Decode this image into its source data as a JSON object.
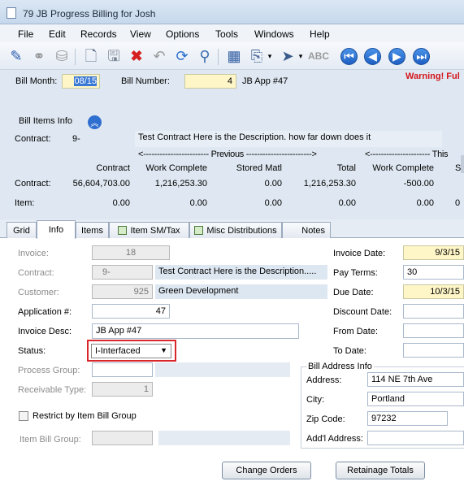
{
  "window": {
    "title": "79 JB Progress Billing for Josh"
  },
  "menu": [
    "File",
    "Edit",
    "Records",
    "View",
    "Options",
    "Tools",
    "Windows",
    "Help"
  ],
  "toolbar": {
    "icons": [
      "edit-icon",
      "binoculars-icon",
      "database-icon",
      "new-document-icon",
      "save-icon",
      "delete-icon",
      "undo-icon",
      "refresh-icon",
      "find-icon",
      "calculator-icon",
      "attach-icon",
      "dropdown-arrow-icon",
      "reports-icon",
      "spellcheck-icon",
      "first-record-icon",
      "prev-record-icon",
      "next-record-icon",
      "last-record-icon"
    ]
  },
  "header": {
    "bill_month_label": "Bill Month:",
    "bill_month_value": "08/15",
    "bill_number_label": "Bill Number:",
    "bill_number_value": "4",
    "bill_desc": "JB App #47",
    "warning": "Warning!  Ful"
  },
  "bill_items": {
    "section_label": "Bill Items Info",
    "contract_label": "Contract:",
    "contract_value": "9-",
    "contract_desc": "Test Contract Here is the Description. how far down does it",
    "previous_banner": "<------------------------ Previous ------------------------>",
    "this_banner": "<---------------------- This",
    "columns": [
      "Contract",
      "Work Complete",
      "Stored Matl",
      "Total",
      "Work Complete",
      "S"
    ],
    "rows": [
      {
        "label": "Contract:",
        "values": [
          "56,604,703.00",
          "1,216,253.30",
          "0.00",
          "1,216,253.30",
          "-500.00",
          ""
        ]
      },
      {
        "label": "Item:",
        "values": [
          "0.00",
          "0.00",
          "0.00",
          "0.00",
          "0.00",
          "0"
        ]
      }
    ]
  },
  "tabs": [
    "Grid",
    "Info",
    "Items",
    "Item SM/Tax",
    "Misc Distributions",
    "Notes"
  ],
  "info": {
    "invoice_label": "Invoice:",
    "invoice_value": "18",
    "contract_label": "Contract:",
    "contract_value": "9-",
    "contract_desc": "Test Contract Here is the Description.....",
    "customer_label": "Customer:",
    "customer_value": "925",
    "customer_name": "Green Development",
    "application_label": "Application #:",
    "application_value": "47",
    "invoice_desc_label": "Invoice Desc:",
    "invoice_desc_value": "JB App #47",
    "status_label": "Status:",
    "status_value": "I-Interfaced",
    "process_group_label": "Process Group:",
    "process_group_value": "",
    "receivable_type_label": "Receivable Type:",
    "receivable_type_value": "1",
    "restrict_label": "Restrict by Item Bill Group",
    "item_bill_group_label": "Item Bill Group:",
    "invoice_date_label": "Invoice Date:",
    "invoice_date_value": "9/3/15",
    "pay_terms_label": "Pay Terms:",
    "pay_terms_value": "30",
    "due_date_label": "Due Date:",
    "due_date_value": "10/3/15",
    "discount_date_label": "Discount Date:",
    "from_date_label": "From Date:",
    "to_date_label": "To Date:",
    "bill_address_label": "Bill Address Info",
    "address_label": "Address:",
    "address_value": "114 NE 7th Ave",
    "city_label": "City:",
    "city_value": "Portland",
    "zip_label": "Zip Code:",
    "zip_value": "97232",
    "addl_label": "Add'l Address:",
    "addl_value": ""
  },
  "buttons": {
    "change_orders": "Change Orders",
    "retainage_totals": "Retainage Totals"
  }
}
